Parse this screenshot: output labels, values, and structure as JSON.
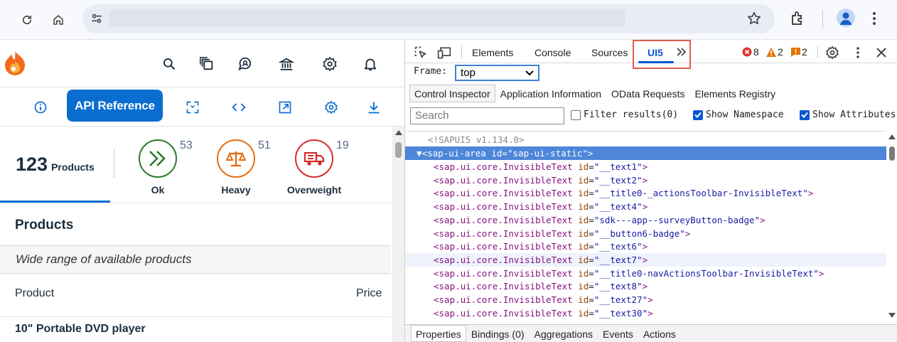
{
  "browser": {
    "url": ""
  },
  "app": {
    "toolbar": {
      "api_reference_label": "API Reference"
    },
    "kpis": {
      "count": "123",
      "count_label": "Products",
      "items": [
        {
          "name": "Ok",
          "badge": "53",
          "color": "#2b7c2b"
        },
        {
          "name": "Heavy",
          "badge": "51",
          "color": "#e26e14"
        },
        {
          "name": "Overweight",
          "badge": "19",
          "color": "#d62c2c"
        }
      ]
    },
    "table": {
      "title": "Products",
      "subtitle": "Wide range of available products",
      "columns": [
        "Product",
        "Price"
      ],
      "rows": [
        {
          "product": "10\" Portable DVD player"
        }
      ]
    }
  },
  "devtools": {
    "tabs": [
      "Elements",
      "Console",
      "Sources",
      "UI5"
    ],
    "active_tab": "UI5",
    "errors": "8",
    "warnings": "2",
    "issues": "2",
    "frame_label": "Frame:",
    "frame_value": "top",
    "sub_tabs": [
      "Control Inspector",
      "Application Information",
      "OData Requests",
      "Elements Registry"
    ],
    "search_placeholder": "Search",
    "filters": [
      {
        "label": "Filter results(0)",
        "checked": false
      },
      {
        "label": "Show Namespace",
        "checked": true
      },
      {
        "label": "Show Attributes",
        "checked": true
      }
    ],
    "tree": {
      "comment": "<!SAPUI5 v1.134.0>",
      "root_tag": "sap-ui-area",
      "root_id": "sap-ui-static",
      "children": [
        {
          "tag": "sap.ui.core.InvisibleText",
          "id": "__text1"
        },
        {
          "tag": "sap.ui.core.InvisibleText",
          "id": "__text2"
        },
        {
          "tag": "sap.ui.core.InvisibleText",
          "id": "__title0-_actionsToolbar-InvisibleText"
        },
        {
          "tag": "sap.ui.core.InvisibleText",
          "id": "__text4"
        },
        {
          "tag": "sap.ui.core.InvisibleText",
          "id": "sdk---app--surveyButton-badge"
        },
        {
          "tag": "sap.ui.core.InvisibleText",
          "id": "__button6-badge"
        },
        {
          "tag": "sap.ui.core.InvisibleText",
          "id": "__text6"
        },
        {
          "tag": "sap.ui.core.InvisibleText",
          "id": "__text7"
        },
        {
          "tag": "sap.ui.core.InvisibleText",
          "id": "__title0-navActionsToolbar-InvisibleText"
        },
        {
          "tag": "sap.ui.core.InvisibleText",
          "id": "__text8"
        },
        {
          "tag": "sap.ui.core.InvisibleText",
          "id": "__text27"
        },
        {
          "tag": "sap.ui.core.InvisibleText",
          "id": "__text30"
        }
      ]
    },
    "bottom_tabs": [
      "Properties",
      "Bindings (0)",
      "Aggregations",
      "Events",
      "Actions"
    ]
  }
}
